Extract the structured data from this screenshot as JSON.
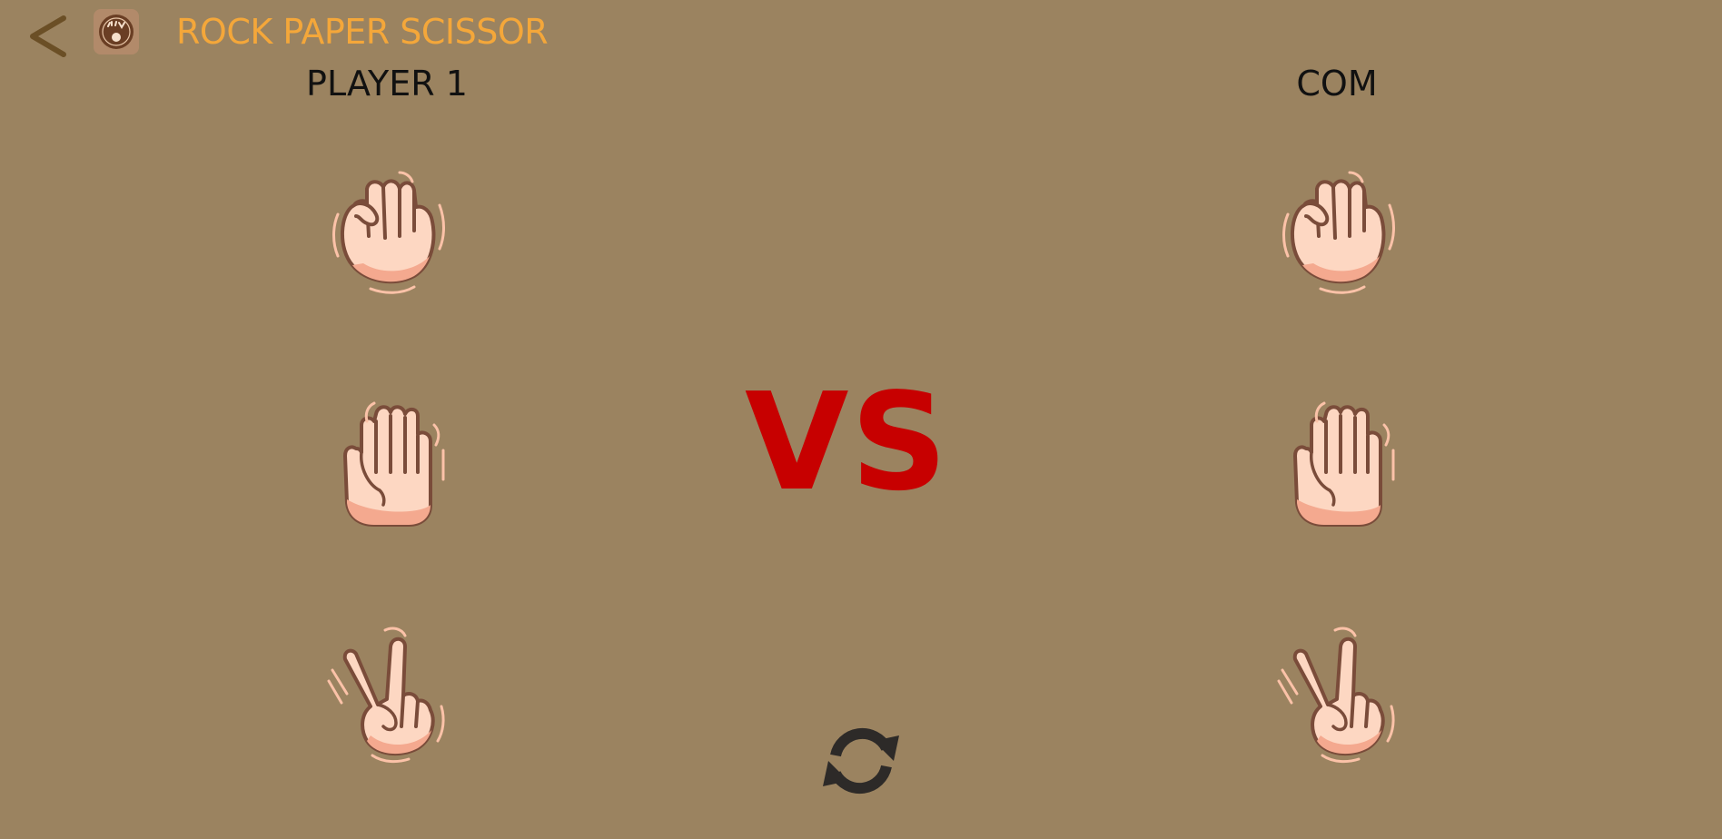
{
  "header": {
    "back_label": "<",
    "back_icon": "chevron-left-icon",
    "logo_icon": "rock-paper-scissor-logo-icon",
    "title": "ROCK PAPER SCISSOR"
  },
  "players": {
    "player1": {
      "label": "PLAYER 1"
    },
    "com": {
      "label": "COM"
    }
  },
  "choices": [
    "rock",
    "paper",
    "scissors"
  ],
  "vs_label": "VS",
  "refresh_icon": "refresh-icon",
  "colors": {
    "background": "#9b8360",
    "title": "#f4a73a",
    "vs": "#c70000",
    "back_arrow": "#6b4f26",
    "skin": "#fdd7c2",
    "skin_shadow": "#f4a98f",
    "outline": "#7a4c3a",
    "refresh": "#2d2a28"
  }
}
